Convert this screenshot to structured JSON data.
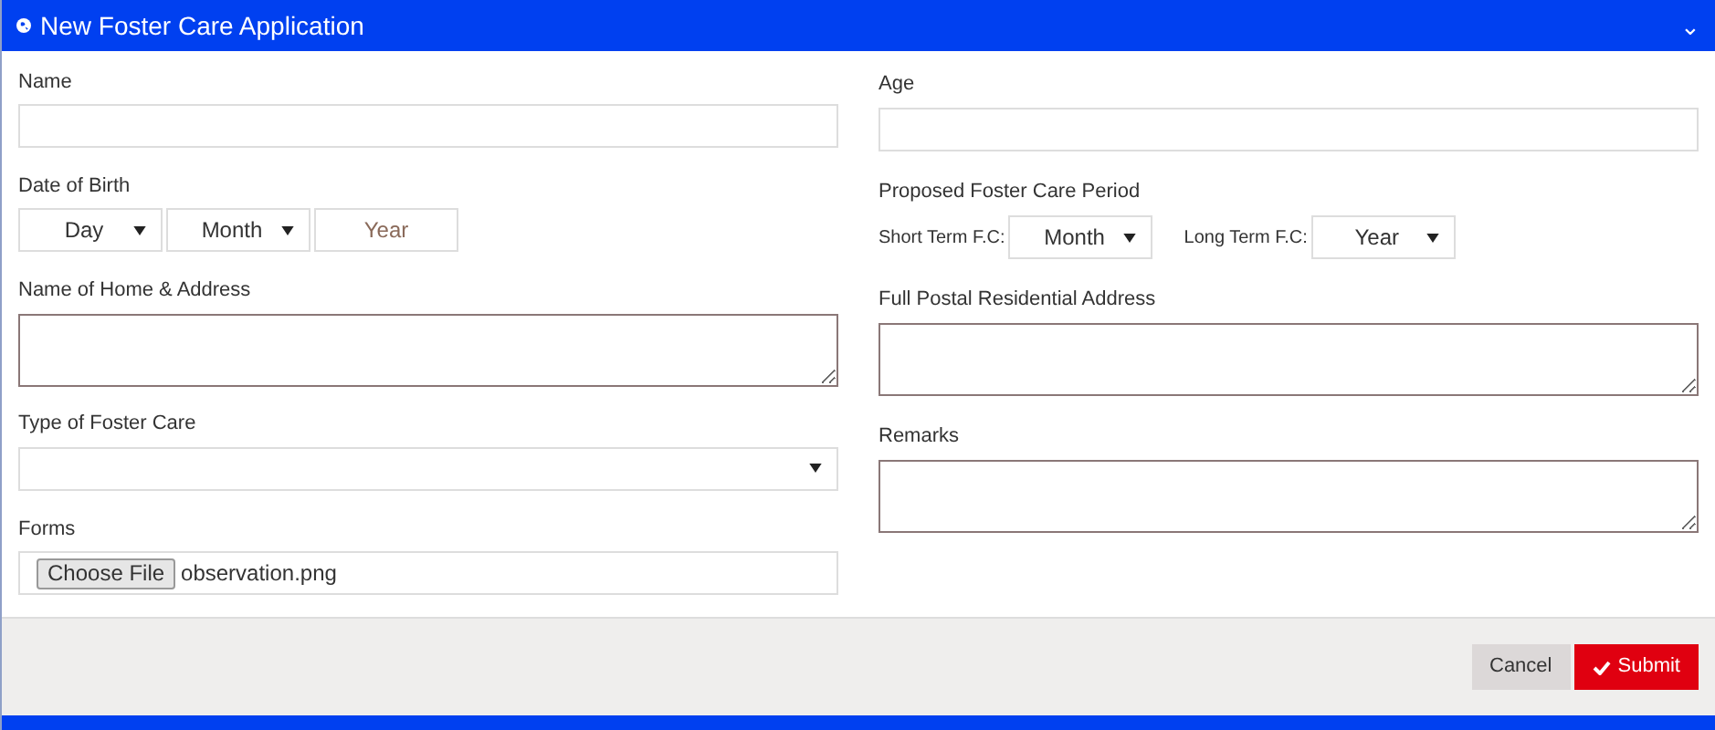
{
  "panel": {
    "title": "New Foster Care Application",
    "collapse_icon": "⌄"
  },
  "left_column": [
    {
      "kind": "text",
      "label": "Name"
    },
    {
      "kind": "date",
      "label": "Date of Birth",
      "day": "Day",
      "month": "Month",
      "year_placeholder": "Year"
    },
    {
      "kind": "textarea",
      "label": "Name of Home & Address"
    },
    {
      "kind": "select",
      "label": "Type of Foster Care"
    },
    {
      "kind": "file",
      "label": "Forms",
      "button": "Choose File",
      "file_name": "observation.png"
    }
  ],
  "right_column": [
    {
      "kind": "text",
      "label": "Age"
    },
    {
      "kind": "period",
      "label": "Proposed Foster Care Period",
      "short_label": "Short Term F.C:",
      "short_value": "Month",
      "long_label": "Long Term F.C:",
      "long_value": "Year"
    },
    {
      "kind": "textarea",
      "label": "Full Postal Residential Address"
    },
    {
      "kind": "textarea",
      "label": "Remarks"
    }
  ],
  "buttons": [
    {
      "kind": "cancel",
      "label": "Cancel"
    },
    {
      "kind": "submit",
      "label": "Submit"
    }
  ]
}
